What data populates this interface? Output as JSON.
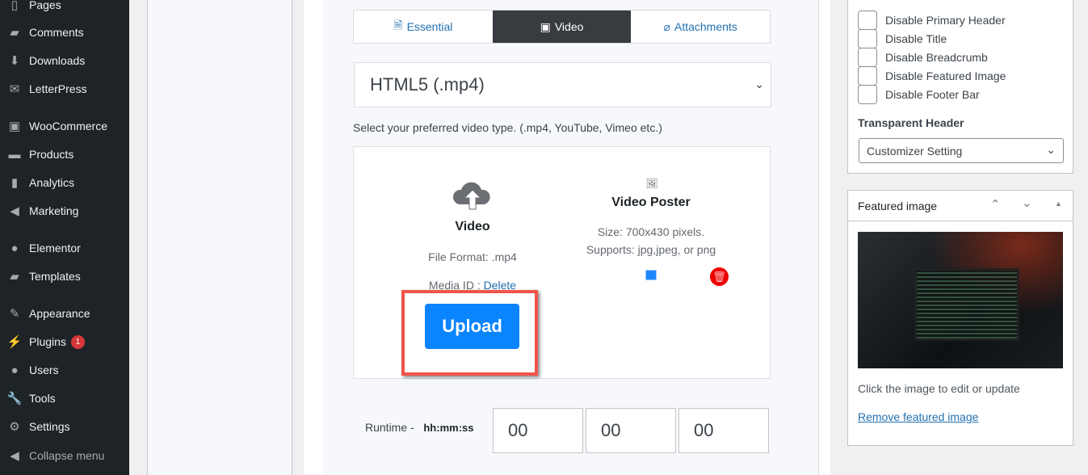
{
  "sidebar": {
    "items": [
      {
        "label": "Pages",
        "icon": "pages-icon",
        "glyph": "▯"
      },
      {
        "label": "Comments",
        "icon": "comments-icon",
        "glyph": "▰"
      },
      {
        "label": "Downloads",
        "icon": "downloads-icon",
        "glyph": "⬇"
      },
      {
        "label": "LetterPress",
        "icon": "envelope-icon",
        "glyph": "✉"
      },
      {
        "label": "WooCommerce",
        "icon": "woocommerce-icon",
        "glyph": "▣"
      },
      {
        "label": "Products",
        "icon": "products-icon",
        "glyph": "▬"
      },
      {
        "label": "Analytics",
        "icon": "analytics-icon",
        "glyph": "▮"
      },
      {
        "label": "Marketing",
        "icon": "megaphone-icon",
        "glyph": "◀"
      },
      {
        "label": "Elementor",
        "icon": "elementor-icon",
        "glyph": "●"
      },
      {
        "label": "Templates",
        "icon": "folder-icon",
        "glyph": "▰"
      },
      {
        "label": "Appearance",
        "icon": "brush-icon",
        "glyph": "✎"
      },
      {
        "label": "Plugins",
        "icon": "plugin-icon",
        "glyph": "⚡",
        "badge": "1"
      },
      {
        "label": "Users",
        "icon": "user-icon",
        "glyph": "●"
      },
      {
        "label": "Tools",
        "icon": "wrench-icon",
        "glyph": "🔧"
      },
      {
        "label": "Settings",
        "icon": "settings-icon",
        "glyph": "⚙"
      },
      {
        "label": "Collapse menu",
        "icon": "collapse-icon",
        "glyph": "◀"
      }
    ]
  },
  "tabs": [
    {
      "label": "Essential",
      "glyph": "🗎"
    },
    {
      "label": "Video",
      "glyph": "🎞"
    },
    {
      "label": "Attachments",
      "glyph": "📎"
    }
  ],
  "video_type": {
    "value": "HTML5 (.mp4)",
    "hint": "Select your preferred video type. (.mp4, YouTube, Vimeo etc.)"
  },
  "video": {
    "title": "Video",
    "format": "File Format: .mp4",
    "media_id": "Media ID :",
    "delete": "Delete",
    "upload": "Upload"
  },
  "poster": {
    "title": "Video Poster",
    "size": "Size: 700x430 pixels.",
    "supports": "Supports: jpg,jpeg, or png"
  },
  "runtime": {
    "label": "Runtime -",
    "format": "hh:mm:ss",
    "hh": "00",
    "mm": "00",
    "ss": "00"
  },
  "sections": {
    "checkboxes": [
      "Disable Primary Header",
      "Disable Title",
      "Disable Breadcrumb",
      "Disable Featured Image",
      "Disable Footer Bar"
    ],
    "transparent_label": "Transparent Header",
    "transparent_value": "Customizer Setting"
  },
  "featured": {
    "title": "Featured image",
    "edit_hint": "Click the image to edit or update",
    "remove": "Remove featured image"
  },
  "colors": {
    "accent": "#0a84ff",
    "highlight": "#f0544a",
    "sidebar": "#1d2327",
    "active_tab": "#383b3f"
  }
}
